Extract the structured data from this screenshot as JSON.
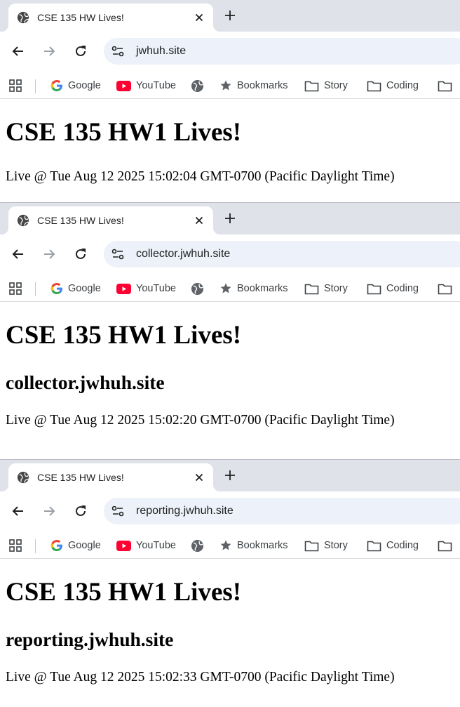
{
  "windows": [
    {
      "tab_title": "CSE 135 HW Lives!",
      "url": "jwhuh.site",
      "heading": "CSE 135 HW1 Lives!",
      "subheading": "",
      "live_text": "Live @ Tue Aug 12 2025 15:02:04 GMT-0700 (Pacific Daylight Time)"
    },
    {
      "tab_title": "CSE 135 HW Lives!",
      "url": "collector.jwhuh.site",
      "heading": "CSE 135 HW1 Lives!",
      "subheading": "collector.jwhuh.site",
      "live_text": "Live @ Tue Aug 12 2025 15:02:20 GMT-0700 (Pacific Daylight Time)"
    },
    {
      "tab_title": "CSE 135 HW Lives!",
      "url": "reporting.jwhuh.site",
      "heading": "CSE 135 HW1 Lives!",
      "subheading": "reporting.jwhuh.site",
      "live_text": "Live @ Tue Aug 12 2025 15:02:33 GMT-0700 (Pacific Daylight Time)"
    }
  ],
  "bookmarks": {
    "google": "Google",
    "youtube": "YouTube",
    "bookmarks": "Bookmarks",
    "story": "Story",
    "coding": "Coding"
  },
  "icons": [
    "globe-icon",
    "close-icon",
    "plus-icon",
    "back-arrow-icon",
    "forward-arrow-icon",
    "reload-icon",
    "site-info-icon",
    "apps-grid-icon",
    "google-icon",
    "youtube-icon",
    "star-icon",
    "folder-icon"
  ],
  "colors": {
    "tabstrip": "#dfe3e9",
    "omnibox": "#edf1f9",
    "youtube_red": "#ff0033",
    "text": "#1f1f1f"
  }
}
